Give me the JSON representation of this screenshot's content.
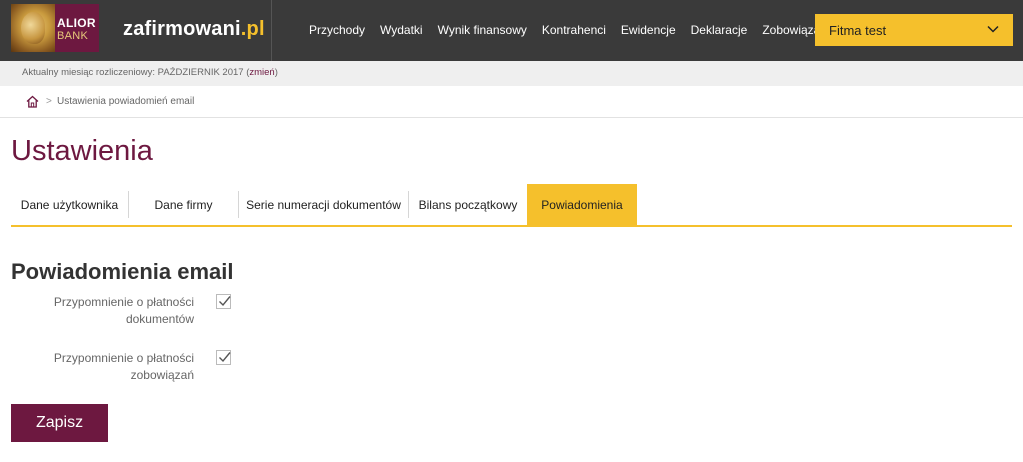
{
  "header": {
    "logo_line1": "ALIOR",
    "logo_line2": "BANK",
    "brand_name": "zafirmowani",
    "brand_tld": ".pl",
    "nav": [
      "Przychody",
      "Wydatki",
      "Wynik finansowy",
      "Kontrahenci",
      "Ewidencje",
      "Deklaracje",
      "Zobowiązania"
    ],
    "company": "Fitma test"
  },
  "month_bar": {
    "prefix": "Aktualny miesiąc rozliczeniowy: PAŹDZIERNIK 2017 (",
    "change_link": "zmień",
    "suffix": ")"
  },
  "breadcrumb": {
    "separator": ">",
    "current": "Ustawienia powiadomień email"
  },
  "page": {
    "title": "Ustawienia",
    "tabs": [
      "Dane użytkownika",
      "Dane firmy",
      "Serie numeracji dokumentów",
      "Bilans początkowy",
      "Powiadomienia"
    ],
    "active_tab": "Powiadomienia"
  },
  "section": {
    "title": "Powiadomienia email",
    "options": [
      {
        "line1": "Przypomnienie o płatności",
        "line2": "dokumentów",
        "checked": true
      },
      {
        "line1": "Przypomnienie o płatności",
        "line2": "zobowiązań",
        "checked": true
      }
    ],
    "save_label": "Zapisz"
  },
  "colors": {
    "accent": "#f5c02c",
    "brand": "#6d1840",
    "topbar": "#3a3a3a"
  }
}
